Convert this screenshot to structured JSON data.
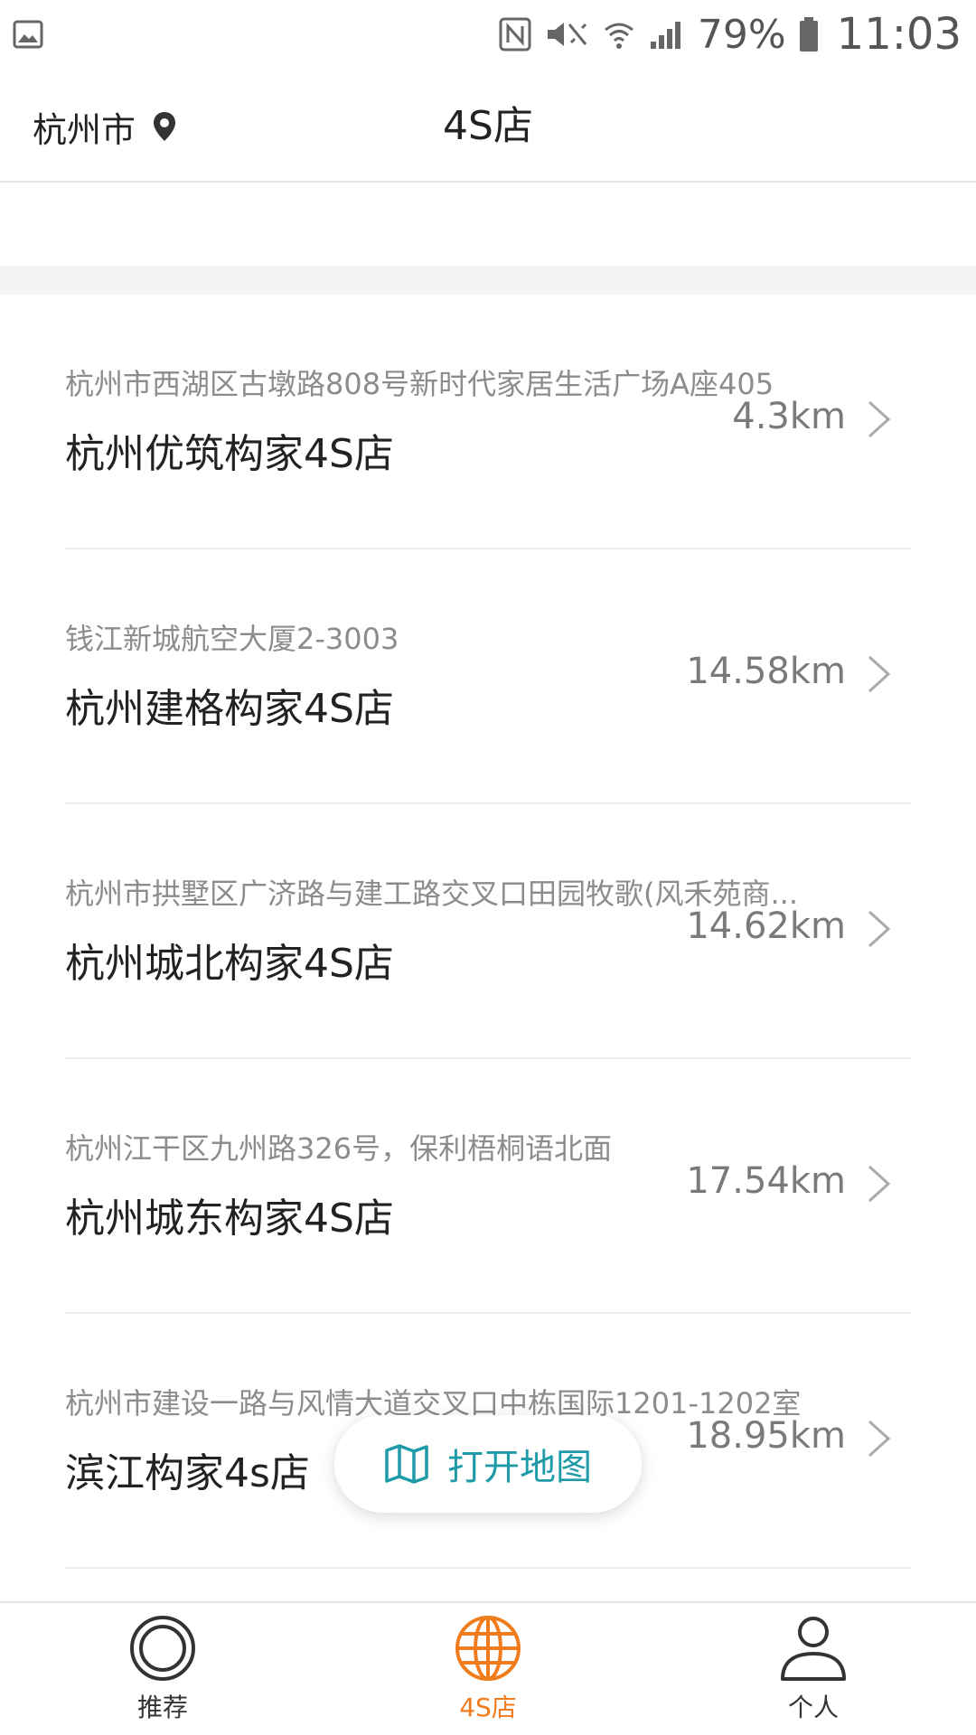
{
  "status_bar": {
    "battery": "79%",
    "time": "11:03"
  },
  "header": {
    "city": "杭州市",
    "title": "4S店"
  },
  "stores": [
    {
      "address": "杭州市西湖区古墩路808号新时代家居生活广场A座405",
      "name": "杭州优筑构家4S店",
      "distance": "4.3km"
    },
    {
      "address": "钱江新城航空大厦2-3003",
      "name": "杭州建格构家4S店",
      "distance": "14.58km"
    },
    {
      "address": "杭州市拱墅区广济路与建工路交叉口田园牧歌(风禾苑商...",
      "name": "杭州城北构家4S店",
      "distance": "14.62km"
    },
    {
      "address": "杭州江干区九州路326号，保利梧桐语北面",
      "name": "杭州城东构家4S店",
      "distance": "17.54km"
    },
    {
      "address": "杭州市建设一路与风情大道交叉口中栋国际1201-1202室",
      "name": "滨江构家4s店",
      "distance": "18.95km"
    }
  ],
  "map_button": {
    "label": "打开地图"
  },
  "bottom_nav": [
    {
      "label": "推荐",
      "icon": "circle-target-icon",
      "active": false
    },
    {
      "label": "4S店",
      "icon": "globe-icon",
      "active": true
    },
    {
      "label": "个人",
      "icon": "person-icon",
      "active": false
    }
  ],
  "colors": {
    "accent": "#f07c1e",
    "map_button": "#1f9aa8"
  }
}
